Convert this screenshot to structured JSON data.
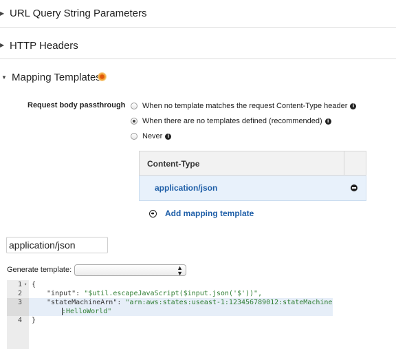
{
  "sections": {
    "url_query": "URL Query String Parameters",
    "http_headers": "HTTP Headers",
    "mapping_templates": "Mapping Templates"
  },
  "passthrough": {
    "label": "Request body passthrough",
    "options": [
      {
        "label": "When no template matches the request Content-Type header",
        "selected": false
      },
      {
        "label": "When there are no templates defined (recommended)",
        "selected": true
      },
      {
        "label": "Never",
        "selected": false
      }
    ]
  },
  "content_type_table": {
    "header": "Content-Type",
    "rows": [
      "application/json"
    ],
    "add_label": "Add mapping template"
  },
  "template_input": {
    "value": "application/json"
  },
  "generate_template": {
    "label": "Generate template:",
    "selected": ""
  },
  "editor": {
    "lines": [
      {
        "num": "1",
        "text": "{"
      },
      {
        "num": "2",
        "key": "\"input\"",
        "val": "\"$util.escapeJavaScript($input.json('$'))\","
      },
      {
        "num": "3",
        "key": "\"stateMachineArn\"",
        "val": "\"arn:aws:states:useast-1:123456789012:stateMachine",
        "wrap": ":HelloWorld\""
      },
      {
        "num": "4",
        "text": "}"
      }
    ]
  },
  "colors": {
    "link": "#1f5fa8",
    "selected_row": "#e8f1fb",
    "code_string": "#2e7d32"
  },
  "icons": [
    "caret-right-icon",
    "caret-down-icon",
    "info-icon",
    "remove-icon",
    "add-icon",
    "select-arrows-icon"
  ]
}
